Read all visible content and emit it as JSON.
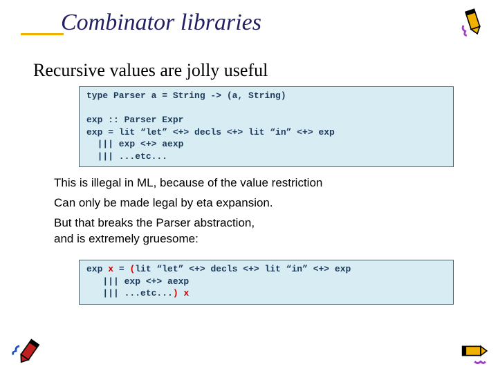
{
  "title": "Combinator libraries",
  "subtitle": "Recursive values are jolly useful",
  "code1": {
    "l1": "type Parser a = String -> (a, String)",
    "l2": "",
    "l3": "exp :: Parser Expr",
    "l4": "exp = lit “let” <+> decls <+> lit “in” <+> exp",
    "l5": "  ||| exp <+> aexp",
    "l6": "  ||| ...etc..."
  },
  "body": {
    "p1": "This is illegal in ML, because of the value restriction",
    "p2": "Can only be made legal by eta expansion.",
    "p3a": "But that breaks the Parser abstraction,",
    "p3b": "and is extremely gruesome:"
  },
  "code2": {
    "pre": "exp ",
    "x1": "x",
    "mid1": " = ",
    "open": "(",
    "body1": "lit “let” <+> decls <+> lit “in” <+> exp",
    "l2": "   ||| exp <+> aexp",
    "l3": "   ||| ...etc...",
    "close": ")",
    "sp": " ",
    "x2": "x"
  }
}
